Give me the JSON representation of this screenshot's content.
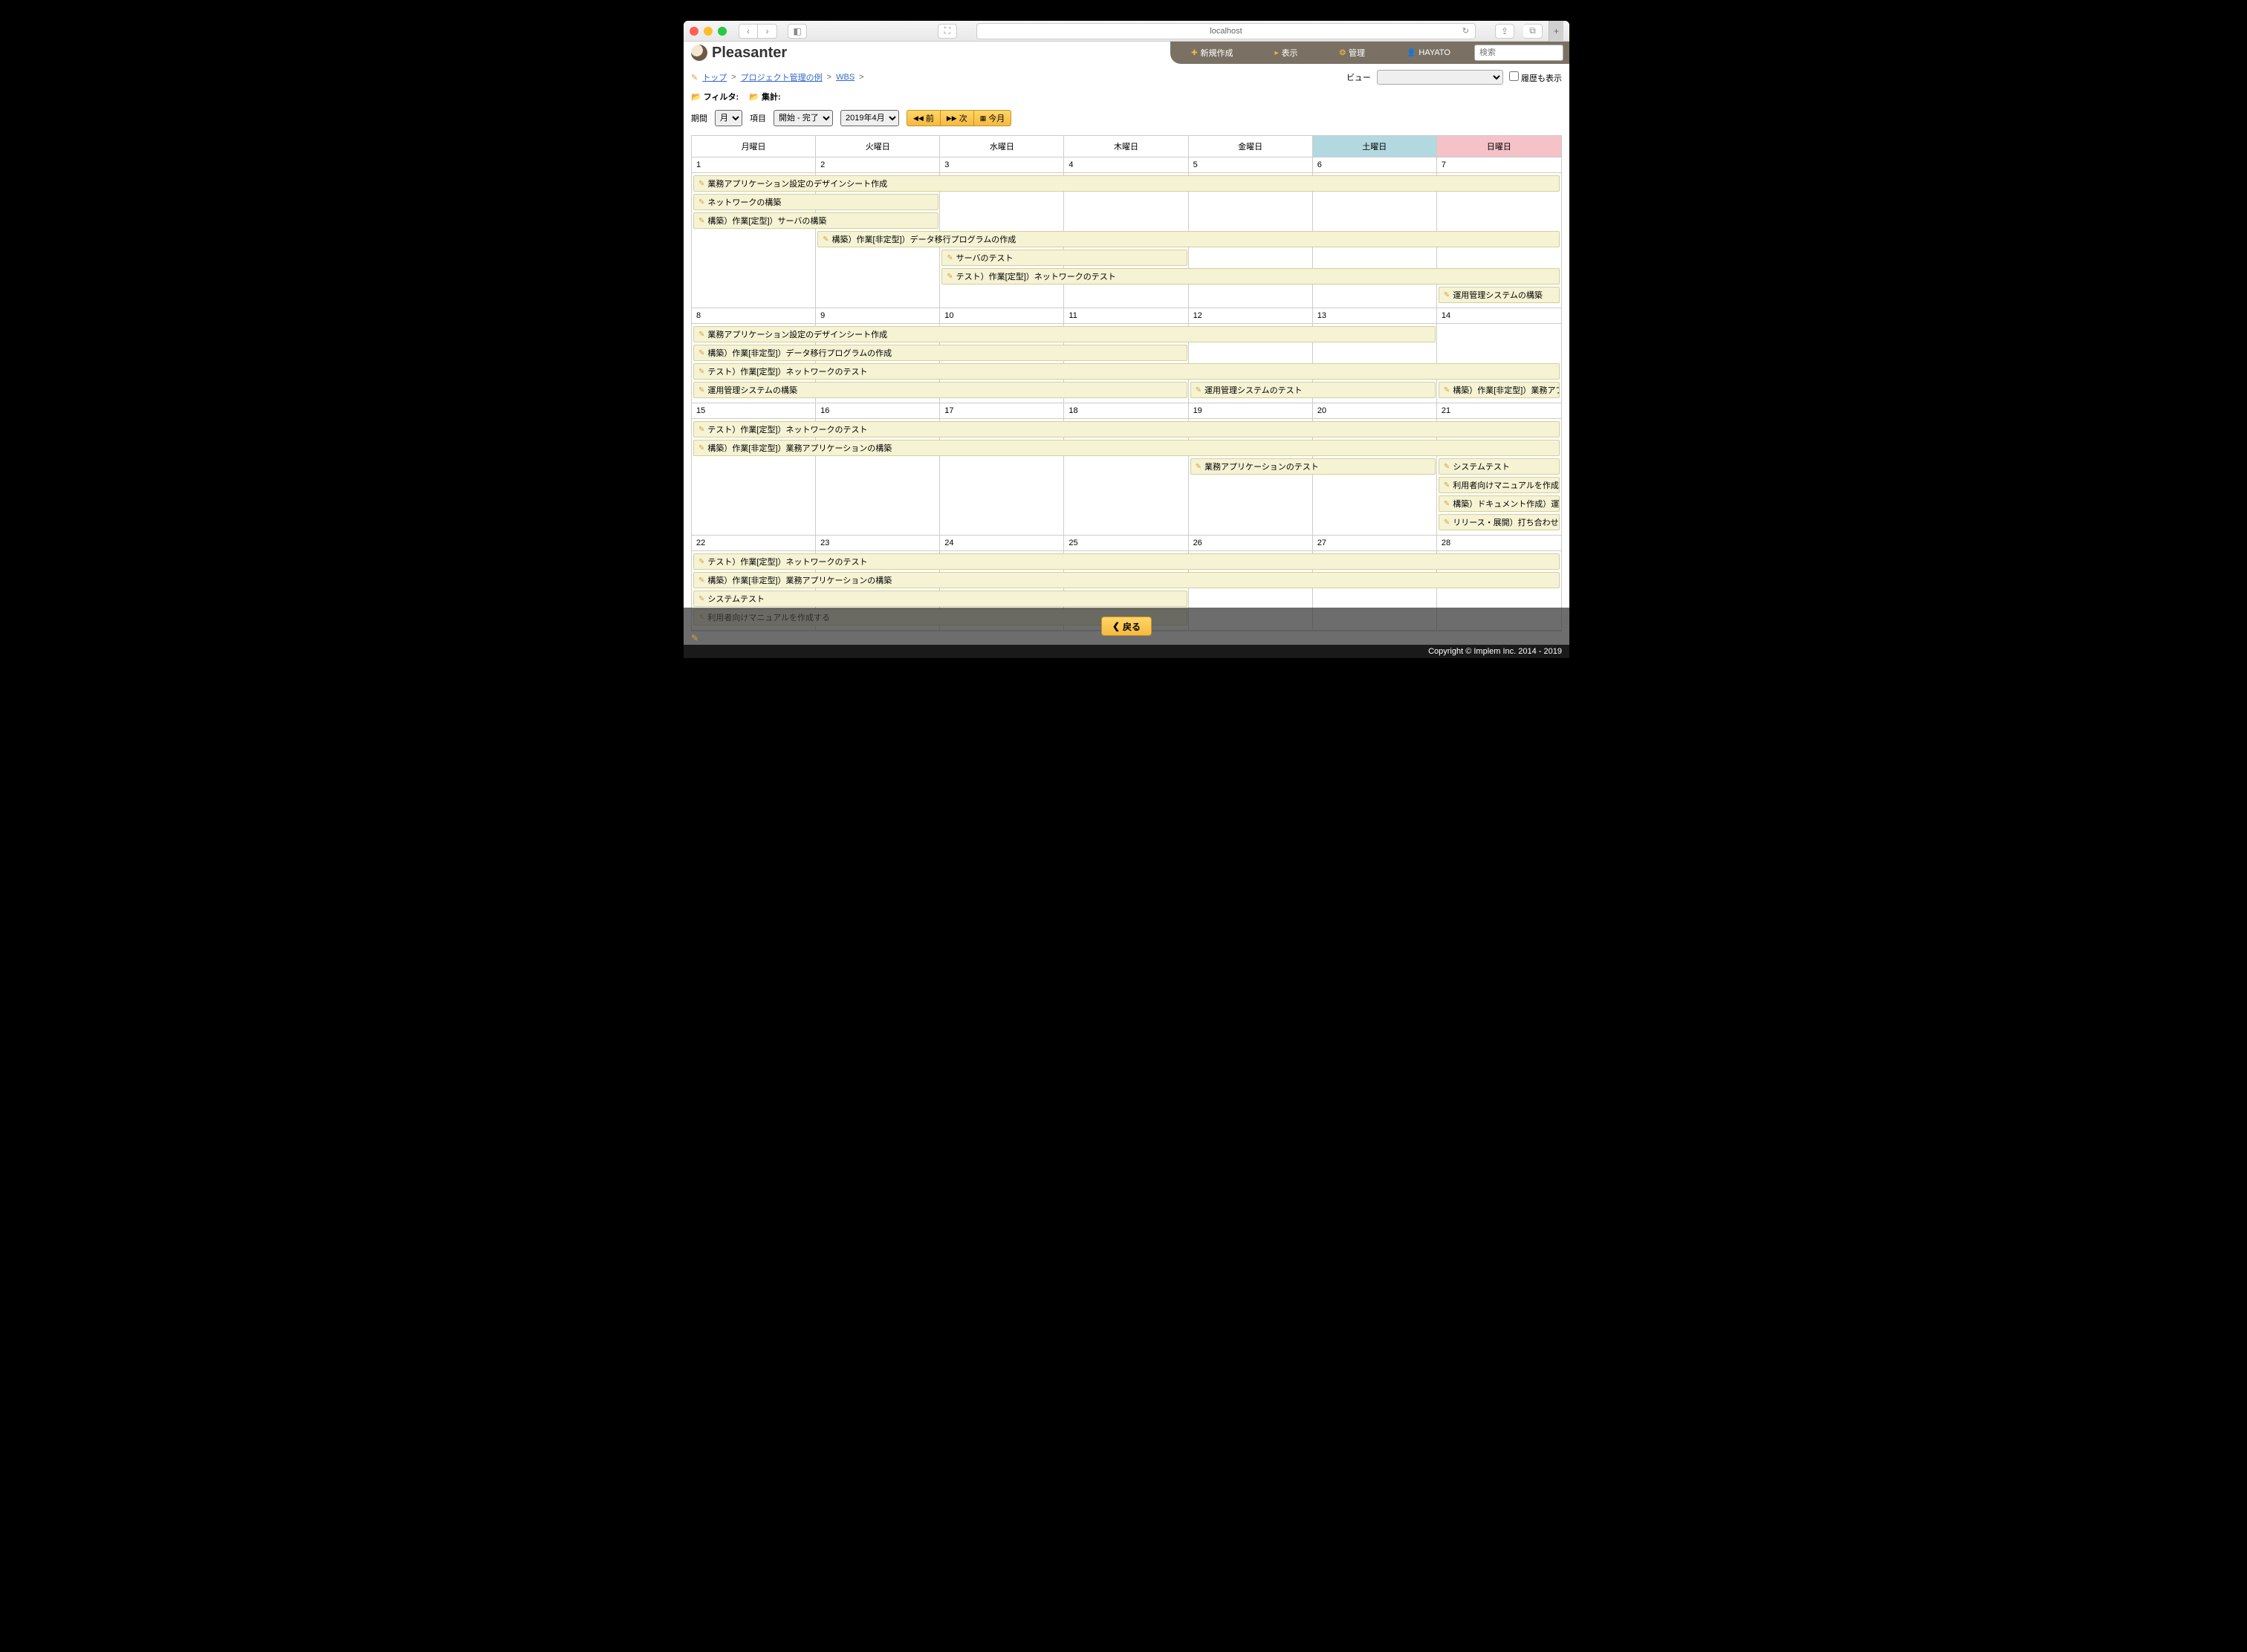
{
  "browser": {
    "url": "localhost"
  },
  "app": {
    "logo": "Pleasanter"
  },
  "nav": {
    "new": "新規作成",
    "view": "表示",
    "manage": "管理",
    "user": "HAYATO",
    "search_placeholder": "検索"
  },
  "breadcrumb": {
    "top": "トップ",
    "project": "プロジェクト管理の例",
    "wbs": "WBS"
  },
  "view": {
    "label": "ビュー",
    "history_label": "履歴も表示"
  },
  "filter": {
    "filter_label": "フィルタ:",
    "agg_label": "集計:"
  },
  "controls": {
    "period_label": "期間",
    "period_value": "月",
    "item_label": "項目",
    "item_value": "開始 - 完了",
    "month_value": "2019年4月",
    "prev": "前",
    "next": "次",
    "today": "今月"
  },
  "dow": [
    "月曜日",
    "火曜日",
    "水曜日",
    "木曜日",
    "金曜日",
    "土曜日",
    "日曜日"
  ],
  "weeks": [
    {
      "dates": [
        "1",
        "2",
        "3",
        "4",
        "5",
        "6",
        "7"
      ],
      "bars": [
        [
          {
            "start": 0,
            "span": 7,
            "label": "業務アプリケーション設定のデザインシート作成"
          }
        ],
        [
          {
            "start": 0,
            "span": 2,
            "label": "ネットワークの構築"
          }
        ],
        [
          {
            "start": 0,
            "span": 2,
            "label": "構築）作業[定型]）サーバの構築"
          }
        ],
        [
          {
            "start": 1,
            "span": 6,
            "label": "構築）作業[非定型]）データ移行プログラムの作成"
          }
        ],
        [
          {
            "start": 2,
            "span": 2,
            "label": "サーバのテスト"
          }
        ],
        [
          {
            "start": 2,
            "span": 5,
            "label": "テスト）作業[定型]）ネットワークのテスト"
          }
        ],
        [
          {
            "start": 6,
            "span": 1,
            "label": "運用管理システムの構築"
          }
        ]
      ]
    },
    {
      "dates": [
        "8",
        "9",
        "10",
        "11",
        "12",
        "13",
        "14"
      ],
      "bars": [
        [
          {
            "start": 0,
            "span": 6,
            "label": "業務アプリケーション設定のデザインシート作成"
          }
        ],
        [
          {
            "start": 0,
            "span": 4,
            "label": "構築）作業[非定型]）データ移行プログラムの作成"
          }
        ],
        [
          {
            "start": 0,
            "span": 7,
            "label": "テスト）作業[定型]）ネットワークのテスト"
          }
        ],
        [
          {
            "start": 0,
            "span": 4,
            "label": "運用管理システムの構築"
          },
          {
            "start": 4,
            "span": 2,
            "label": "運用管理システムのテスト"
          },
          {
            "start": 6,
            "span": 1,
            "label": "構築）作業[非定型]）業務アプ"
          }
        ]
      ]
    },
    {
      "dates": [
        "15",
        "16",
        "17",
        "18",
        "19",
        "20",
        "21"
      ],
      "bars": [
        [
          {
            "start": 0,
            "span": 7,
            "label": "テスト）作業[定型]）ネットワークのテスト"
          }
        ],
        [
          {
            "start": 0,
            "span": 7,
            "label": "構築）作業[非定型]）業務アプリケーションの構築"
          }
        ],
        [
          {
            "start": 4,
            "span": 2,
            "label": "業務アプリケーションのテスト"
          },
          {
            "start": 6,
            "span": 1,
            "label": "システムテスト"
          }
        ],
        [
          {
            "start": 6,
            "span": 1,
            "label": "利用者向けマニュアルを作成する"
          }
        ],
        [
          {
            "start": 6,
            "span": 1,
            "label": "構築）ドキュメント作成）運用"
          }
        ],
        [
          {
            "start": 6,
            "span": 1,
            "label": "リリース・展開）打ち合わせ）"
          }
        ]
      ]
    },
    {
      "dates": [
        "22",
        "23",
        "24",
        "25",
        "26",
        "27",
        "28"
      ],
      "bars": [
        [
          {
            "start": 0,
            "span": 7,
            "label": "テスト）作業[定型]）ネットワークのテスト"
          }
        ],
        [
          {
            "start": 0,
            "span": 7,
            "label": "構築）作業[非定型]）業務アプリケーションの構築"
          }
        ],
        [
          {
            "start": 0,
            "span": 4,
            "label": "システムテスト"
          }
        ],
        [
          {
            "start": 0,
            "span": 4,
            "label": "利用者向けマニュアルを作成する"
          }
        ]
      ]
    }
  ],
  "footer": {
    "back": "戻る",
    "copyright": "Copyright © Implem Inc. 2014 - 2019"
  }
}
